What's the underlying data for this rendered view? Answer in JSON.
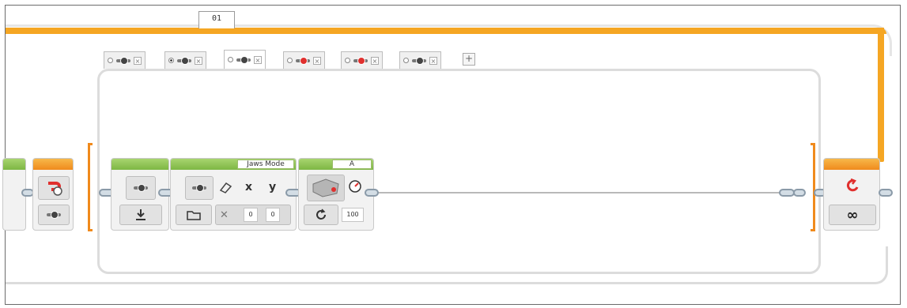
{
  "loop": {
    "label": "01",
    "mode_icon": "infinity-icon",
    "end_icon": "loop-repeat-icon"
  },
  "switch_tabs": [
    {
      "icon": "sensor-icon",
      "close": "×",
      "selected": false,
      "active": false
    },
    {
      "icon": "sensor-icon",
      "close": "×",
      "selected": true,
      "active": false
    },
    {
      "icon": "sensor-icon",
      "close": "×",
      "selected": false,
      "active": true
    },
    {
      "icon": "sensor-red-icon",
      "close": "×",
      "selected": false,
      "active": false
    },
    {
      "icon": "sensor-red-icon",
      "close": "×",
      "selected": false,
      "active": false
    },
    {
      "icon": "sensor-icon",
      "close": "×",
      "selected": false,
      "active": false
    }
  ],
  "switch_add": "+",
  "blocks": {
    "image_block": {
      "header_label": "Jaws Mode",
      "x_label": "x",
      "y_label": "y",
      "x_value": "0",
      "y_value": "0"
    },
    "motor_block": {
      "port": "A",
      "power": "100"
    }
  },
  "colors": {
    "loop": "#f5a623",
    "green_header": "#7db743",
    "switch_border": "#dcdcdc"
  }
}
